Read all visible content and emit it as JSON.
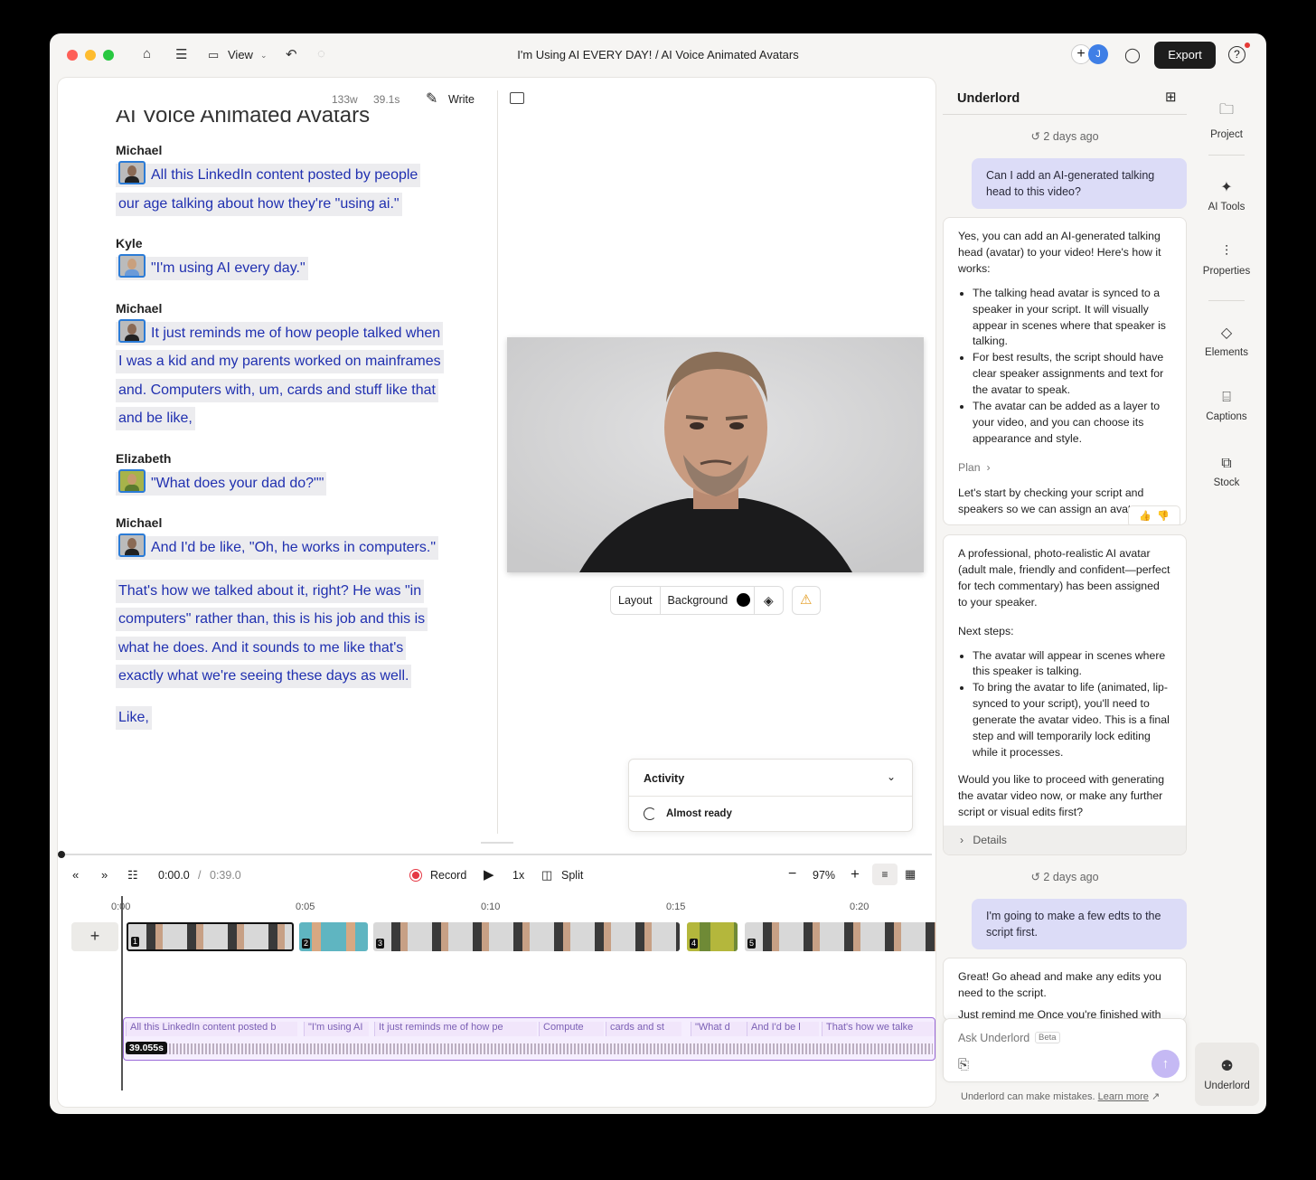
{
  "titlebar": {
    "view_label": "View",
    "title": "I'm Using AI EVERY DAY!  /  AI Voice Animated Avatars",
    "avatar_initial": "J",
    "export_label": "Export"
  },
  "editor": {
    "word_count": "133w",
    "duration": "39.1s",
    "write_label": "Write",
    "doc_title": "AI Voice Animated Avatars",
    "script": [
      {
        "speaker": "Michael",
        "text": "All this LinkedIn content posted by people our age talking about how they're \"using ai.\""
      },
      {
        "speaker": "Kyle",
        "text": "\"I'm using AI every day.\""
      },
      {
        "speaker": "Michael",
        "text": "It just reminds me of how people talked when I was a kid and my parents worked on mainframes and. Computers with, um, cards and stuff like that and be like,"
      },
      {
        "speaker": "Elizabeth",
        "text": "\"What does your dad do?\"\""
      },
      {
        "speaker": "Michael",
        "text": "And I'd be like, \"Oh, he works in computers.\""
      },
      {
        "speaker": "",
        "text": "That's how we talked about it, right? He was \"in computers\" rather than, this is his job and this is what he does. And it sounds to me like that's exactly what we're seeing these days as well."
      },
      {
        "speaker": "",
        "text": "Like,"
      }
    ],
    "preview_bar": {
      "layout": "Layout",
      "background": "Background"
    },
    "activity": {
      "title": "Activity",
      "status": "Almost ready"
    }
  },
  "timeline": {
    "current_time": "0:00.0",
    "total_time": "0:39.0",
    "record_label": "Record",
    "speed": "1x",
    "split_label": "Split",
    "zoom": "97%",
    "ticks": [
      "0:00",
      "0:05",
      "0:10",
      "0:15",
      "0:20"
    ],
    "clip_numbers": [
      "1",
      "2",
      "3",
      "4",
      "5"
    ],
    "audio_duration": "39.055s",
    "audio_segments": [
      "All this LinkedIn content posted b",
      "\"I'm using AI",
      "It just reminds me of how pe",
      "Compute",
      "cards and st",
      "\"What d",
      "And I'd be l",
      "That's how we talke"
    ]
  },
  "panel": {
    "title": "Underlord",
    "timestamp_1": "2 days ago",
    "user_msg_1": "Can I add an AI-generated talking head to this video?",
    "ai_msg_1_intro": "Yes, you can add an AI-generated talking head (avatar) to your video! Here's how it works:",
    "ai_msg_1_bullets": [
      "The talking head avatar is synced to a speaker in your script. It will visually appear in scenes where that speaker is talking.",
      "For best results, the script should have clear speaker assignments and text for the avatar to speak.",
      "The avatar can be added as a layer to your video, and you can choose its appearance and style."
    ],
    "plan_label": "Plan",
    "ai_msg_1_tail": "Let's start by checking your script and speakers so we can assign an avatar.",
    "ai_msg_2_intro": "A professional, photo-realistic AI avatar (adult male, friendly and confident—perfect for tech commentary) has been assigned to your speaker.",
    "next_steps": "Next steps:",
    "ai_msg_2_bullets": [
      "The avatar will appear in scenes where this speaker is talking.",
      "To bring the avatar to life (animated, lip-synced to your script), you'll need to generate the avatar video. This is a final step and will temporarily lock editing while it processes."
    ],
    "ai_msg_2_question": "Would you like to proceed with generating the avatar video now, or make any further script or visual edits first?",
    "details_label": "Details",
    "timestamp_2": "2 days ago",
    "user_msg_2": "I'm going to make a few edts to the script first.",
    "ai_msg_3": "Great! Go ahead and make any edits you need to the script.",
    "ai_msg_3_hidden": "Just remind me Once you're finished with",
    "input_placeholder": "Ask Underlord",
    "beta_label": "Beta",
    "disclaimer": "Underlord can make mistakes.",
    "learn_more": "Learn more"
  },
  "rail": [
    {
      "label": "Project",
      "icon": "folder-icon"
    },
    {
      "label": "AI Tools",
      "icon": "sparkle-icon"
    },
    {
      "label": "Properties",
      "icon": "sliders-icon"
    },
    {
      "label": "Elements",
      "icon": "shapes-icon"
    },
    {
      "label": "Captions",
      "icon": "captions-icon"
    },
    {
      "label": "Stock",
      "icon": "stock-icon"
    },
    {
      "label": "Underlord",
      "icon": "robot-icon"
    }
  ]
}
